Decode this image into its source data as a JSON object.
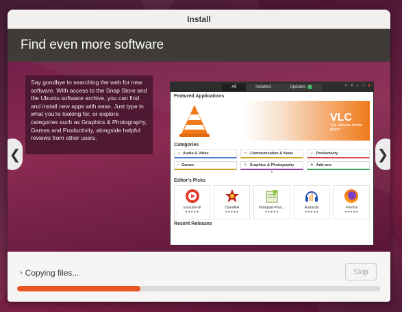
{
  "window": {
    "title": "Install"
  },
  "header": {
    "title": "Find even more software"
  },
  "slide": {
    "description": "Say goodbye to searching the web for new software. With access to the Snap Store and the Ubuntu software archive, you can find and install new apps with ease. Just type in what you're looking for, or explore categories such as Graphics & Photography, Games and Productivity, alongside helpful reviews from other users.",
    "prev_glyph": "❮",
    "next_glyph": "❯"
  },
  "software_app": {
    "tabs": [
      {
        "label": "All"
      },
      {
        "label": "Installed"
      },
      {
        "label": "Updates"
      }
    ],
    "updates_badge": "7",
    "featured_title": "Featured Applications",
    "banner": {
      "title": "VLC",
      "subtitle": "The ultimate media player"
    },
    "categories_title": "Categories",
    "categories": [
      {
        "label": "Audio & Video",
        "icon": "music-icon",
        "color": "#4a7bd0"
      },
      {
        "label": "Communication & News",
        "icon": "chat-icon",
        "color": "#c9a227"
      },
      {
        "label": "Productivity",
        "icon": "check-icon",
        "color": "#d24a4a"
      },
      {
        "label": "Games",
        "icon": "gamepad-icon",
        "color": "#c9a227"
      },
      {
        "label": "Graphics & Photography",
        "icon": "brush-icon",
        "color": "#8a3fa3"
      },
      {
        "label": "Add-ons",
        "icon": "puzzle-icon",
        "color": "#3aa657"
      }
    ],
    "editors_title": "Editor's Picks",
    "picks": [
      {
        "name": "youtube-dl",
        "stars": "★★★★★"
      },
      {
        "name": "OpenRA",
        "stars": "★★★★★"
      },
      {
        "name": "Notepad-Plus...",
        "stars": "★★★★★"
      },
      {
        "name": "Audacity",
        "stars": "★★★★★"
      },
      {
        "name": "Firefox",
        "stars": "★★★★★"
      }
    ],
    "recent_title": "Recent Releases"
  },
  "footer": {
    "status": "Copying files...",
    "skip_label": "Skip",
    "progress": 0.34,
    "accent": "#e95420"
  }
}
